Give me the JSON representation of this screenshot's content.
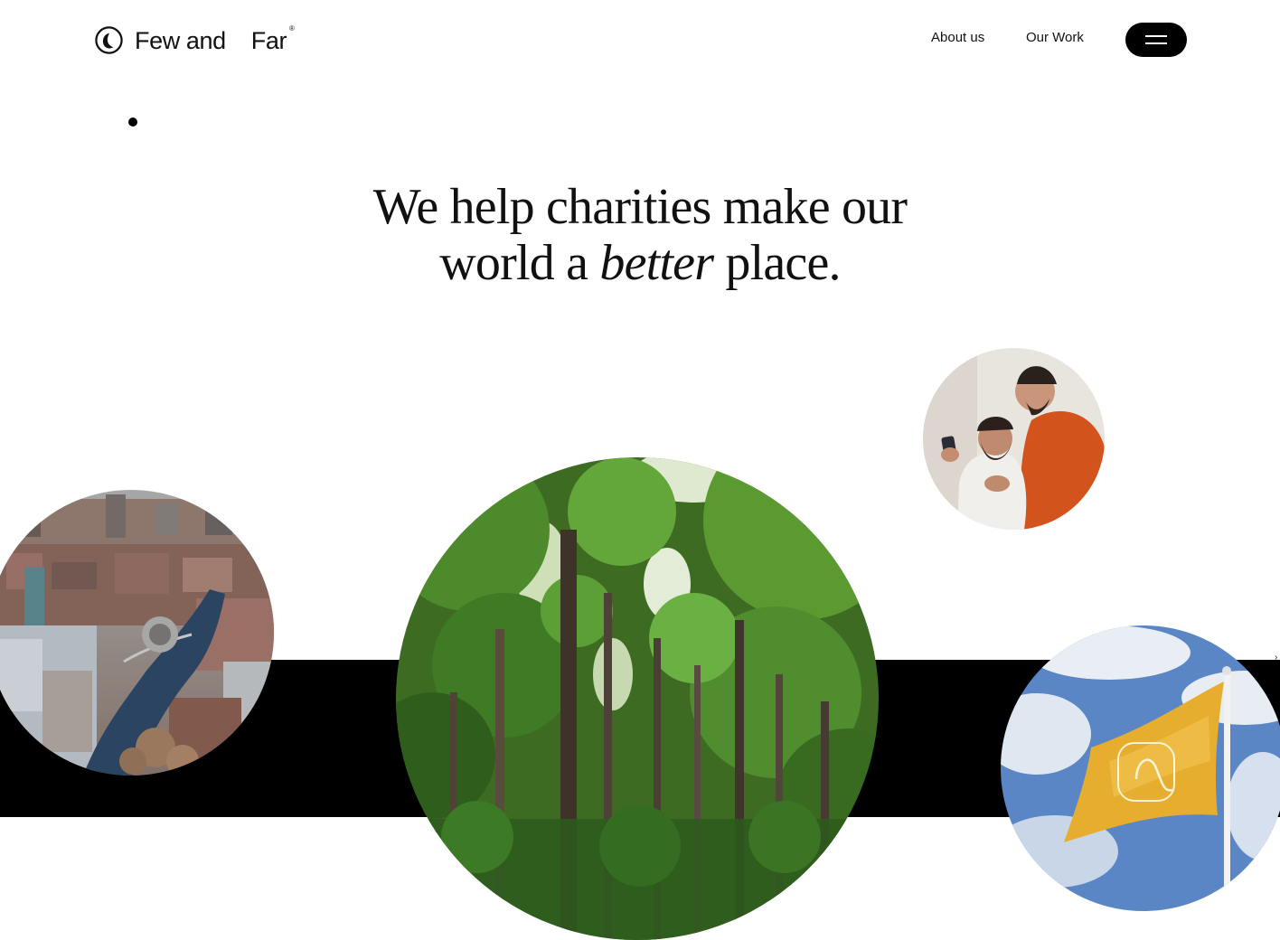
{
  "brand": {
    "word1": "Few and",
    "word2": "Far",
    "registered": "®",
    "icon": "leaf-circle-logo-icon"
  },
  "nav": {
    "about_label": "About us",
    "work_label": "Our Work",
    "menu_icon": "hamburger-menu-icon"
  },
  "hero": {
    "line1": "We help charities make our",
    "line2_prefix": "world a ",
    "line2_emphasis": "better",
    "line2_suffix": " place."
  },
  "images": {
    "city": "aerial-city-canal-photo",
    "forest": "forest-trees-photo",
    "people": "two-men-looking-at-phone-photo",
    "flag": "yellow-flag-sky-photo"
  },
  "colors": {
    "background": "#ffffff",
    "text": "#111111",
    "band": "#000000",
    "menu_button": "#000000"
  }
}
